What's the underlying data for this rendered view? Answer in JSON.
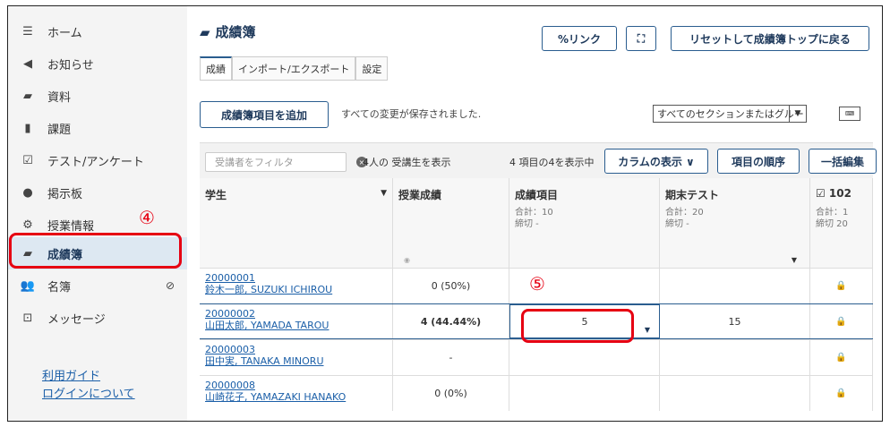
{
  "nav": {
    "items": [
      {
        "icon": "list-icon",
        "glyph": "☰",
        "label": "ホーム"
      },
      {
        "icon": "megaphone-icon",
        "glyph": "📢",
        "label": "お知らせ"
      },
      {
        "icon": "folder-icon",
        "glyph": "▰",
        "label": "資料"
      },
      {
        "icon": "document-icon",
        "glyph": "▮",
        "label": "課題"
      },
      {
        "icon": "checkbox-icon",
        "glyph": "☑",
        "label": "テスト/アンケート"
      },
      {
        "icon": "chat-bubbles-icon",
        "glyph": "●",
        "label": "掲示板"
      },
      {
        "icon": "gear-icon",
        "glyph": "⚙",
        "label": "授業情報"
      },
      {
        "icon": "book-icon",
        "glyph": "▰",
        "label": "成績簿"
      },
      {
        "icon": "users-icon",
        "glyph": "👥",
        "label": "名簿"
      },
      {
        "icon": "inbox-icon",
        "glyph": "⊡",
        "label": "メッセージ"
      }
    ],
    "guide_link": "利用ガイド",
    "login_link": "ログインについて"
  },
  "annotations": {
    "step4": "④",
    "step5": "⑤"
  },
  "header": {
    "title": "成績簿",
    "link_button": "%リンク",
    "expand_glyph": "⛶",
    "reset_button": "リセットして成績簿トップに戻る"
  },
  "tabs": [
    "成績",
    "インポート/エクスポート",
    "設定"
  ],
  "toolbar": {
    "add_item_button": "成績簿項目を追加",
    "saved_text": "すべての変更が保存されました.",
    "section_select": "すべてのセクションまたはグルー",
    "keyboard_glyph": "⌨"
  },
  "grid_bar": {
    "filter_placeholder": "受講者をフィルタ",
    "student_count": "4人の 受講生を表示",
    "item_count": "4 項目の4を表示中",
    "columns_button": "カラムの表示 ∨",
    "order_button": "項目の順序",
    "bulk_edit_button": "一括編集"
  },
  "columns": [
    {
      "title": "学生",
      "sub": ""
    },
    {
      "title": "授業成績",
      "sub": ""
    },
    {
      "title": "成績項目",
      "sub": "合計：10\n締切 -"
    },
    {
      "title": "期末テスト",
      "sub": "合計：20\n締切 -"
    },
    {
      "title": "☑ 102",
      "sub": "合計：1\n締切 20"
    }
  ],
  "rows": [
    {
      "id": "20000001",
      "name": "鈴木一郎, SUZUKI ICHIROU",
      "course": "0 (50%)",
      "item": "",
      "final": ""
    },
    {
      "id": "20000002",
      "name": "山田太郎, YAMADA TAROU",
      "course": "4 (44.44%)",
      "item": "5",
      "final": "15"
    },
    {
      "id": "20000003",
      "name": "田中実, TANAKA MINORU",
      "course": "-",
      "item": "",
      "final": ""
    },
    {
      "id": "20000008",
      "name": "山崎花子, YAMAZAKI HANAKO",
      "course": "0 (0%)",
      "item": "",
      "final": ""
    }
  ],
  "colors": {
    "accent": "#2a5d8f",
    "highlight": "#e60012"
  }
}
